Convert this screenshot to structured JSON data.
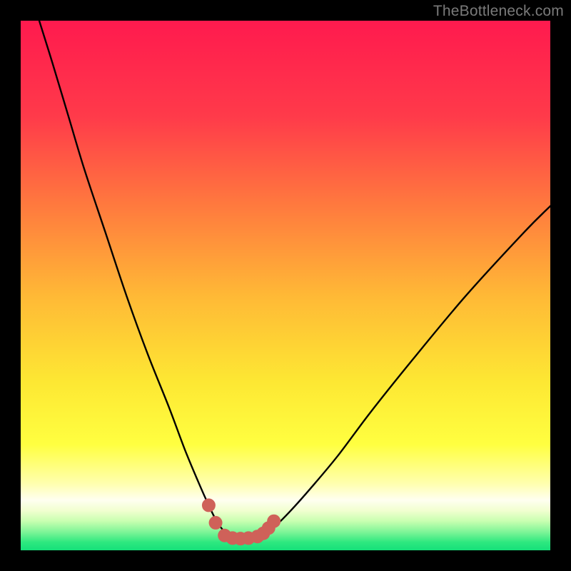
{
  "watermark": "TheBottleneck.com",
  "colors": {
    "black": "#000000",
    "watermark": "#7a7a7a",
    "curve": "#000000",
    "dots": "#cf6159"
  },
  "chart_data": {
    "type": "line",
    "title": "",
    "xlabel": "",
    "ylabel": "",
    "xlim": [
      0,
      100
    ],
    "ylim": [
      0,
      100
    ],
    "series": [
      {
        "name": "bottleneck-curve",
        "x": [
          3.5,
          6,
          9,
          12,
          16,
          20,
          24,
          28,
          31,
          33.5,
          35.5,
          37,
          38.5,
          40,
          41.5,
          43,
          44.5,
          46,
          48,
          51,
          55,
          60,
          66,
          74,
          84,
          95,
          100
        ],
        "y": [
          100,
          92,
          82,
          72,
          60,
          48,
          37,
          27,
          19,
          13,
          8.5,
          5.5,
          3.5,
          2.5,
          2.2,
          2.2,
          2.4,
          3,
          4.5,
          7.5,
          12,
          18,
          26,
          36,
          48,
          60,
          65
        ]
      }
    ],
    "dots": {
      "name": "flat-region-markers",
      "x": [
        35.5,
        36.8,
        38.5,
        40,
        41.5,
        43,
        44.7,
        45.8,
        46.8,
        47.8
      ],
      "y": [
        8.5,
        5.2,
        2.8,
        2.3,
        2.2,
        2.3,
        2.6,
        3.2,
        4.2,
        5.5
      ]
    },
    "gradient_stops": [
      {
        "offset": 0.0,
        "color": "#ff1a4e"
      },
      {
        "offset": 0.18,
        "color": "#ff3a4a"
      },
      {
        "offset": 0.35,
        "color": "#ff7a3e"
      },
      {
        "offset": 0.52,
        "color": "#ffb936"
      },
      {
        "offset": 0.68,
        "color": "#fde733"
      },
      {
        "offset": 0.8,
        "color": "#ffff40"
      },
      {
        "offset": 0.875,
        "color": "#ffffb0"
      },
      {
        "offset": 0.905,
        "color": "#fffff0"
      },
      {
        "offset": 0.925,
        "color": "#f1ffd0"
      },
      {
        "offset": 0.945,
        "color": "#c8ffb0"
      },
      {
        "offset": 0.965,
        "color": "#80f598"
      },
      {
        "offset": 0.985,
        "color": "#2de87f"
      },
      {
        "offset": 1.0,
        "color": "#16e07a"
      }
    ]
  }
}
